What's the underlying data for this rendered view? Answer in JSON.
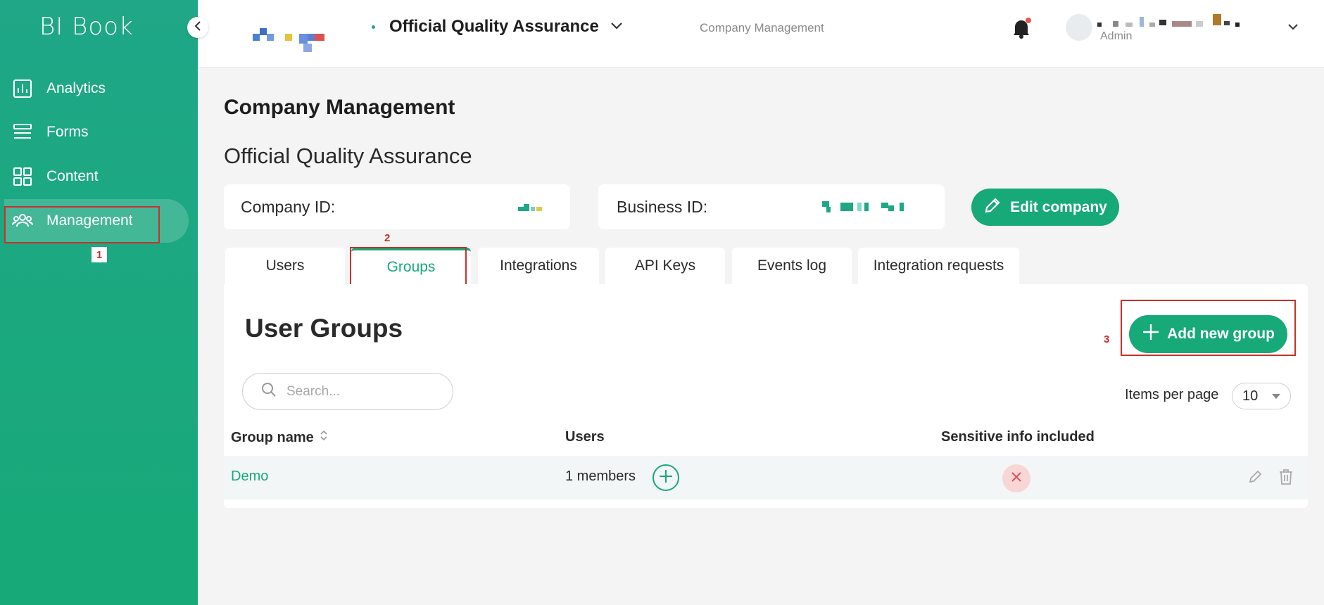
{
  "app": {
    "logo": "BI Book"
  },
  "sidebar": {
    "items": [
      {
        "label": "Analytics",
        "icon": "chart-icon"
      },
      {
        "label": "Forms",
        "icon": "list-icon"
      },
      {
        "label": "Content",
        "icon": "grid-icon"
      },
      {
        "label": "Management",
        "icon": "users-icon",
        "active": true
      }
    ]
  },
  "header": {
    "company": "Official Quality Assurance",
    "breadcrumb": "Company Management",
    "user_role": "Admin"
  },
  "page": {
    "title": "Company Management",
    "company_name": "Official Quality Assurance",
    "company_id_label": "Company ID:",
    "business_id_label": "Business ID:",
    "edit_button": "Edit company"
  },
  "tabs": [
    {
      "label": "Users"
    },
    {
      "label": "Groups",
      "active": true
    },
    {
      "label": "Integrations"
    },
    {
      "label": "API Keys"
    },
    {
      "label": "Events log"
    },
    {
      "label": "Integration requests"
    }
  ],
  "groups": {
    "title": "User Groups",
    "add_button": "Add new group",
    "search_placeholder": "Search...",
    "items_per_page_label": "Items per page",
    "items_per_page": "10",
    "columns": [
      "Group name",
      "Users",
      "Sensitive info included"
    ],
    "rows": [
      {
        "name": "Demo",
        "users": "1 members",
        "sensitive": false
      }
    ]
  },
  "annotations": [
    "1",
    "2",
    "3"
  ],
  "colors": {
    "brand": "#17a977",
    "annotation": "#c9302c",
    "danger_bg": "#f8d6d6"
  }
}
